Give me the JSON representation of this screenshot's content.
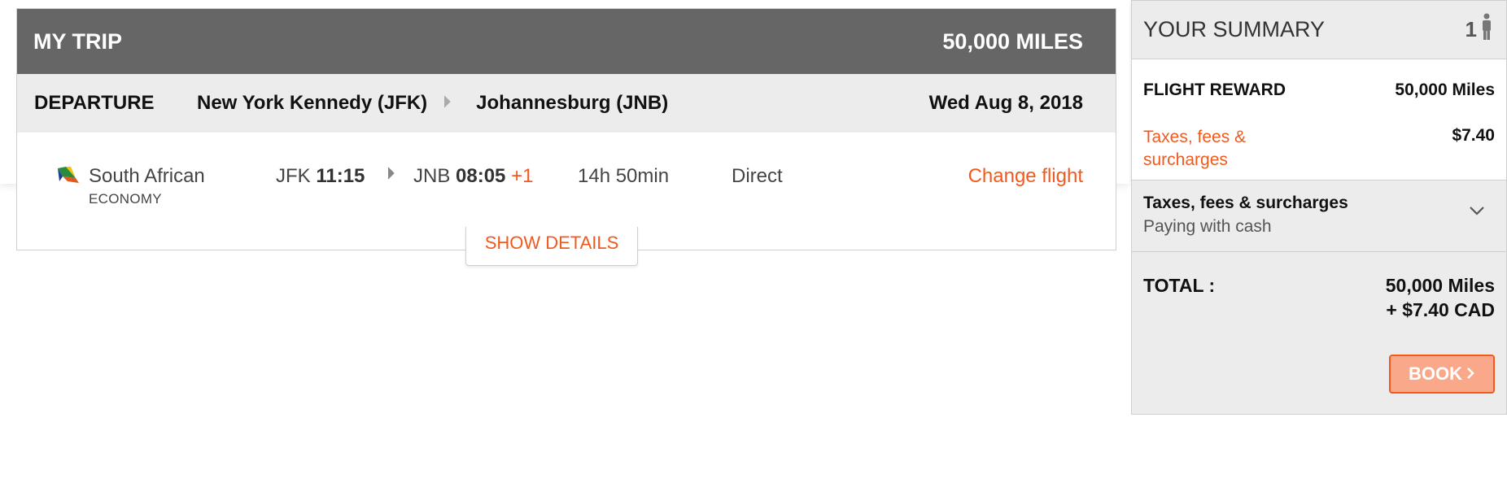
{
  "trip": {
    "title": "MY TRIP",
    "total_miles": "50,000 MILES",
    "departure": {
      "label": "DEPARTURE",
      "from": "New York Kennedy (JFK)",
      "to": "Johannesburg (JNB)",
      "date": "Wed Aug 8, 2018"
    },
    "flight": {
      "airline": "South African",
      "airline_logo_icon": "south-african-airways-logo-icon",
      "cabin": "ECONOMY",
      "dep_airport": "JFK",
      "dep_time": "11:15",
      "arr_airport": "JNB",
      "arr_time": "08:05",
      "arr_day_offset": "+1",
      "duration": "14h 50min",
      "stops": "Direct",
      "change_label": "Change flight"
    },
    "show_details_label": "SHOW DETAILS"
  },
  "summary": {
    "title": "YOUR SUMMARY",
    "passenger_count": "1",
    "passenger_icon": "person-icon",
    "flight_reward_label": "FLIGHT REWARD",
    "flight_reward_value": "50,000 Miles",
    "taxes_label": "Taxes, fees & surcharges",
    "taxes_value": "$7.40",
    "taxes_section_title": "Taxes, fees & surcharges",
    "taxes_section_sub": "Paying with cash",
    "total_label": "TOTAL :",
    "total_miles": "50,000  Miles",
    "total_cash": "+ $7.40  CAD",
    "book_label": "BOOK"
  },
  "colors": {
    "accent": "#f05a1e",
    "header_bg": "#666666",
    "row_bg": "#ececec",
    "book_bg": "#f9a98a"
  }
}
